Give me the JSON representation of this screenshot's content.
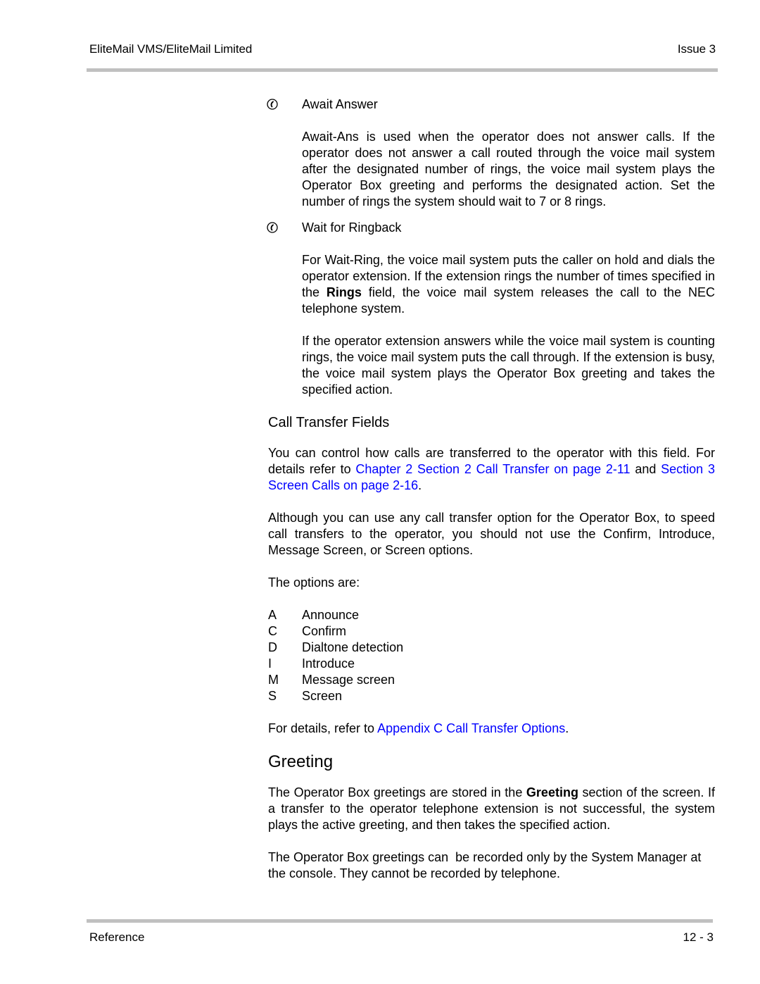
{
  "header": {
    "title": "EliteMail VMS/EliteMail Limited",
    "issue": "Issue 3"
  },
  "footer": {
    "section": "Reference",
    "page_number": "12 - 3"
  },
  "await_answer": {
    "icon": "phone-handset-icon",
    "title": "Await Answer",
    "body": "Await-Ans is used when the operator does not answer calls. If the operator does not answer a call routed through the voice mail system after the designated number of rings, the voice mail system plays the Operator Box greeting and performs the designated action. Set the number of rings the system should wait to 7 or 8 rings."
  },
  "wait_for_ringback": {
    "icon": "phone-handset-icon",
    "title": "Wait for Ringback",
    "para1_before": "For Wait-Ring, the voice mail system puts the caller on hold and dials the operator extension. If the extension rings the number of times specified in the ",
    "para1_bold": "Rings",
    "para1_after": " field, the voice mail system releases the call to the NEC telephone system.",
    "para2": "If the operator extension answers while the voice mail system is counting rings, the voice mail system puts the call through. If the extension is busy, the voice mail system plays the Operator Box greeting and takes the specified action."
  },
  "call_transfer": {
    "heading": "Call Transfer Fields",
    "intro_before": "You can control how calls are transferred to the operator with this field. For details refer to ",
    "link1": "Chapter 2 Section 2 Call Transfer on page 2-11",
    "intro_middle": " and ",
    "link2": "Section 3 Screen Calls on page 2-16",
    "intro_after": ".",
    "although": "Although you can use any call transfer option for the Operator Box, to speed call transfers to the operator, you should not use the Confirm, Introduce, Message Screen, or Screen options.",
    "options_intro": "The options are:",
    "options": [
      {
        "code": "A",
        "label": "Announce"
      },
      {
        "code": "C",
        "label": "Confirm"
      },
      {
        "code": "D",
        "label": "Dialtone detection"
      },
      {
        "code": "I",
        "label": "Introduce"
      },
      {
        "code": "M",
        "label": "Message screen"
      },
      {
        "code": "S",
        "label": "Screen"
      }
    ],
    "details_before": "For details, refer to ",
    "details_link": "Appendix C Call Transfer Options",
    "details_after": "."
  },
  "greeting": {
    "heading": "Greeting",
    "para1_before": "The Operator Box greetings are stored in the ",
    "para1_bold": "Greeting",
    "para1_after": " section of the screen. If a transfer to the operator telephone extension is not successful, the system plays the active greeting, and then takes the specified action.",
    "para2": "The Operator Box greetings can  be recorded only by the System Manager at the console. They cannot be recorded by telephone."
  },
  "colors": {
    "link": "#0000ff",
    "rule": "#c0c0c0",
    "text": "#000000"
  }
}
